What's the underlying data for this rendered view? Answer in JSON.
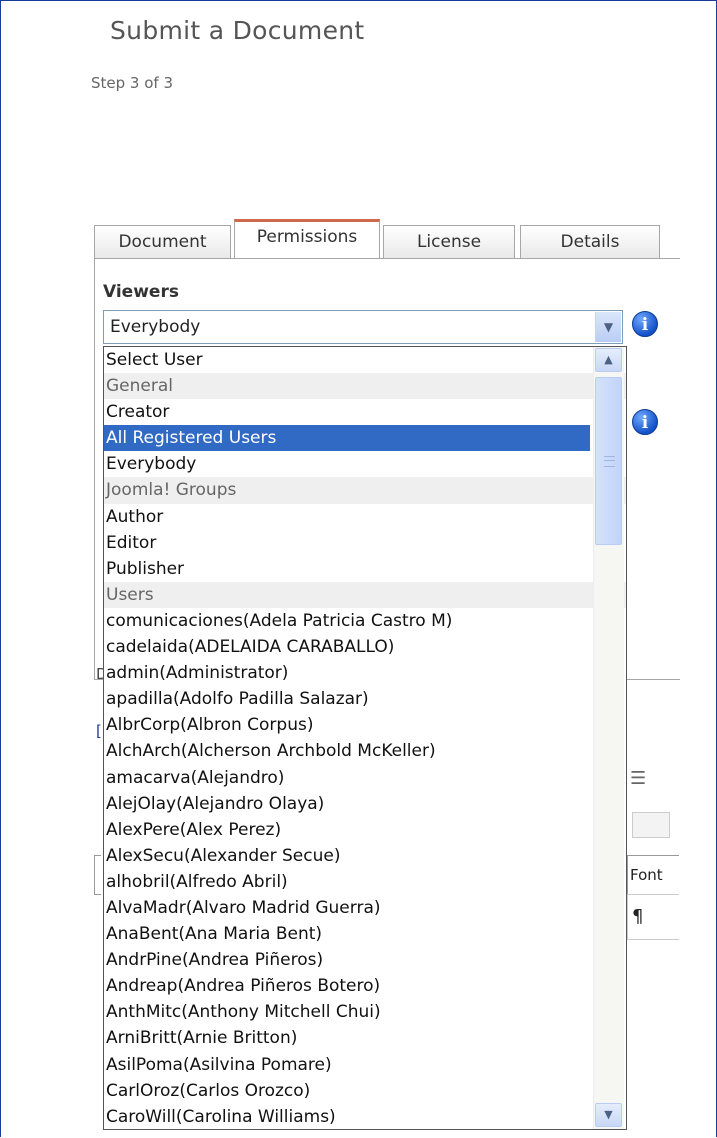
{
  "page": {
    "title": "Submit a Document",
    "step": "Step 3 of 3"
  },
  "tabs": [
    {
      "label": "Document"
    },
    {
      "label": "Permissions",
      "active": true
    },
    {
      "label": "License"
    },
    {
      "label": "Details"
    }
  ],
  "viewers": {
    "label": "Viewers",
    "selected_value": "Everybody"
  },
  "dropdown": {
    "options": [
      {
        "label": "Select User",
        "kind": "option"
      },
      {
        "label": "General",
        "kind": "group"
      },
      {
        "label": "Creator",
        "kind": "option"
      },
      {
        "label": "All Registered Users",
        "kind": "option",
        "highlighted": true
      },
      {
        "label": "Everybody",
        "kind": "option"
      },
      {
        "label": "Joomla! Groups",
        "kind": "group"
      },
      {
        "label": "Author",
        "kind": "option"
      },
      {
        "label": "Editor",
        "kind": "option"
      },
      {
        "label": "Publisher",
        "kind": "option"
      },
      {
        "label": "Users",
        "kind": "group"
      },
      {
        "label": "comunicaciones(Adela Patricia Castro M)",
        "kind": "option"
      },
      {
        "label": "cadelaida(ADELAIDA CARABALLO)",
        "kind": "option"
      },
      {
        "label": "admin(Administrator)",
        "kind": "option"
      },
      {
        "label": "apadilla(Adolfo Padilla Salazar)",
        "kind": "option"
      },
      {
        "label": "AlbrCorp(Albron Corpus)",
        "kind": "option"
      },
      {
        "label": "AlchArch(Alcherson Archbold McKeller)",
        "kind": "option"
      },
      {
        "label": "amacarva(Alejandro)",
        "kind": "option"
      },
      {
        "label": "AlejOlay(Alejandro Olaya)",
        "kind": "option"
      },
      {
        "label": "AlexPere(Alex Perez)",
        "kind": "option"
      },
      {
        "label": "AlexSecu(Alexander Secue)",
        "kind": "option"
      },
      {
        "label": "alhobril(Alfredo Abril)",
        "kind": "option"
      },
      {
        "label": "AlvaMadr(Alvaro Madrid Guerra)",
        "kind": "option"
      },
      {
        "label": "AnaBent(Ana Maria Bent)",
        "kind": "option"
      },
      {
        "label": "AndrPine(Andrea Piñeros)",
        "kind": "option"
      },
      {
        "label": "Andreap(Andrea Piñeros Botero)",
        "kind": "option"
      },
      {
        "label": "AnthMitc(Anthony Mitchell Chui)",
        "kind": "option"
      },
      {
        "label": "ArniBritt(Arnie Britton)",
        "kind": "option"
      },
      {
        "label": "AsilPoma(Asilvina Pomare)",
        "kind": "option"
      },
      {
        "label": "CarlOroz(Carlos Orozco)",
        "kind": "option"
      },
      {
        "label": "CaroWill(Carolina Williams)",
        "kind": "option"
      }
    ]
  },
  "background": {
    "partial_d": "D",
    "partial_bracket": "[",
    "toolbar_font": "Font",
    "pilcrow": "¶",
    "list_glyph": "☰"
  },
  "colors": {
    "selection": "#316ac5",
    "active_tab_accent": "#d0684c",
    "frame_border": "#1a3a9c"
  },
  "icons": [
    "info-icon",
    "chevron-down-icon",
    "chevron-up-icon",
    "scroll-grip-icon"
  ]
}
